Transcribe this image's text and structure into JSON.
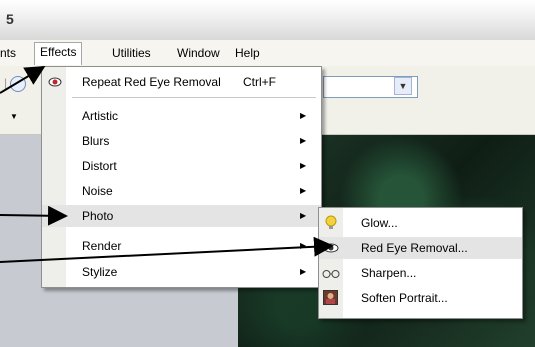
{
  "window": {
    "title": "5"
  },
  "menubar": {
    "partial_left": "nts",
    "items": [
      "Effects",
      "Utilities",
      "Window",
      "Help"
    ]
  },
  "effects_menu": {
    "repeat_label": "Repeat Red Eye Removal",
    "repeat_shortcut": "Ctrl+F",
    "items": [
      "Artistic",
      "Blurs",
      "Distort",
      "Noise",
      "Photo",
      "Render",
      "Stylize"
    ]
  },
  "photo_submenu": {
    "items": [
      "Glow...",
      "Red Eye Removal...",
      "Sharpen...",
      "Soften Portrait..."
    ]
  },
  "icons": {
    "repeat": "eye-icon",
    "glow": "lightbulb-icon",
    "red_eye": "eye-icon",
    "sharpen": "glasses-icon",
    "soften": "portrait-icon",
    "combo": "chevron-down-icon"
  }
}
